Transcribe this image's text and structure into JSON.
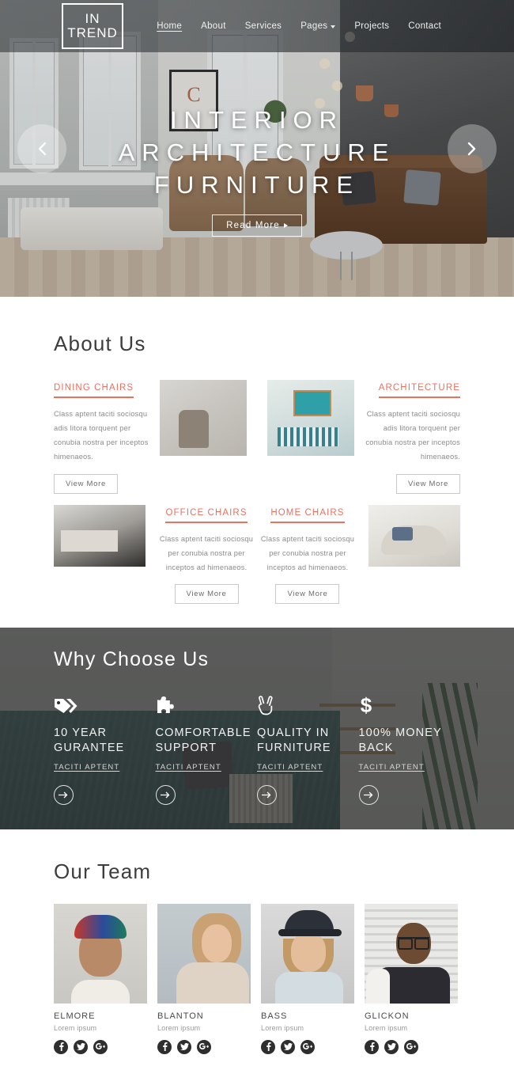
{
  "header": {
    "logo": {
      "line1": "IN",
      "line2": "TREND"
    },
    "nav": [
      {
        "label": "Home",
        "active": true,
        "dropdown": false
      },
      {
        "label": "About",
        "active": false,
        "dropdown": false
      },
      {
        "label": "Services",
        "active": false,
        "dropdown": false
      },
      {
        "label": "Pages",
        "active": false,
        "dropdown": true
      },
      {
        "label": "Projects",
        "active": false,
        "dropdown": false
      },
      {
        "label": "Contact",
        "active": false,
        "dropdown": false
      }
    ]
  },
  "hero": {
    "line1": "INTERIOR",
    "line2": "ARCHITECTURE",
    "line3": "FURNITURE",
    "cta": "Read More",
    "prev_icon": "chevron-left-icon",
    "next_icon": "chevron-right-icon"
  },
  "about": {
    "title": "About Us",
    "items": [
      {
        "heading": "DINING CHAIRS",
        "body": "Class aptent taciti sociosqu adis litora torquent per conubia nostra per inceptos himenaeos.",
        "button": "View More",
        "align": "left"
      },
      {
        "heading": "ARCHITECTURE",
        "body": "Class aptent taciti sociosqu adis litora torquent per conubia nostra per inceptos himenaeos.",
        "button": "View More",
        "align": "right"
      },
      {
        "heading": "OFFICE CHAIRS",
        "body": "Class aptent taciti sociosqu per conubia nostra per inceptos ad himenaeos.",
        "button": "View More",
        "align": "center"
      },
      {
        "heading": "HOME CHAIRS",
        "body": "Class aptent taciti sociosqu per conubia nostra per inceptos ad himenaeos.",
        "button": "View More",
        "align": "center"
      }
    ]
  },
  "why": {
    "title": "Why Choose Us",
    "columns": [
      {
        "icon": "tags-icon",
        "heading": "10 YEAR GURANTEE",
        "link": "TACITI APTENT",
        "arrow": "arrow-right-icon"
      },
      {
        "icon": "puzzle-icon",
        "heading": "COMFORTABLE SUPPORT",
        "link": "TACITI APTENT",
        "arrow": "arrow-right-icon"
      },
      {
        "icon": "peace-hand-icon",
        "heading": "QUALITY IN FURNITURE",
        "link": "TACITI APTENT",
        "arrow": "arrow-right-icon"
      },
      {
        "icon": "dollar-icon",
        "heading": "100% MONEY BACK",
        "link": "TACITI APTENT",
        "arrow": "arrow-right-icon"
      }
    ]
  },
  "team": {
    "title": "Our Team",
    "members": [
      {
        "name": "ELMORE",
        "role": "Lorem ipsum"
      },
      {
        "name": "BLANTON",
        "role": "Lorem ipsum"
      },
      {
        "name": "BASS",
        "role": "Lorem ipsum"
      },
      {
        "name": "GLICKON",
        "role": "Lorem ipsum"
      }
    ],
    "social": [
      {
        "icon": "facebook-icon"
      },
      {
        "icon": "twitter-icon"
      },
      {
        "icon": "google-plus-icon"
      }
    ]
  },
  "colors": {
    "accent": "#e8705f",
    "dark": "#2e2e2e",
    "overlay": "#2c2e2e",
    "text": "#3a3a3a",
    "muted": "#8b8b8b"
  }
}
